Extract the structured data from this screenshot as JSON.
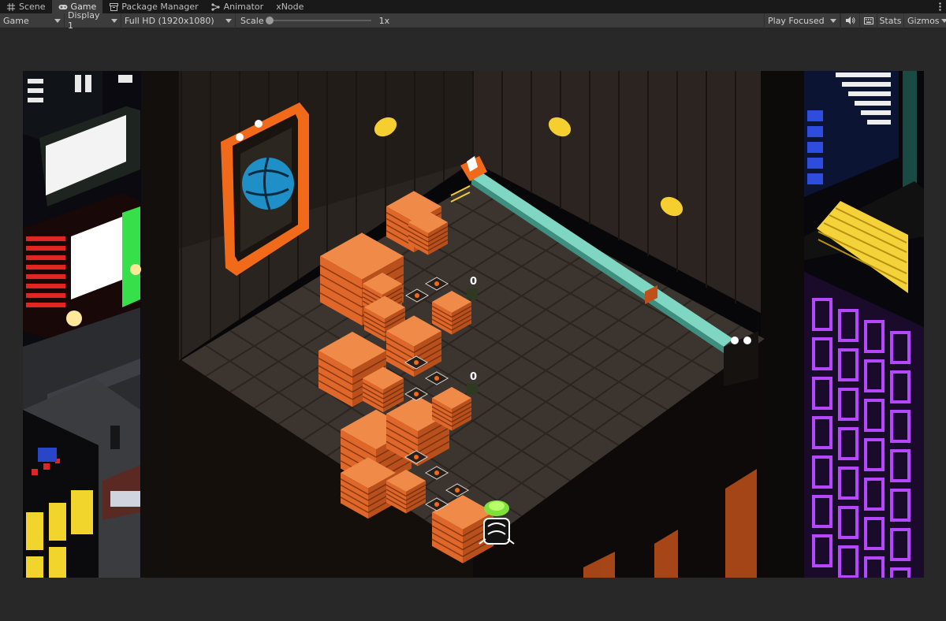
{
  "tabs": [
    {
      "label": "Scene",
      "icon": "grid-icon",
      "active": false
    },
    {
      "label": "Game",
      "icon": "gamepad-icon",
      "active": true
    },
    {
      "label": "Package Manager",
      "icon": "package-icon",
      "active": false
    },
    {
      "label": "Animator",
      "icon": "animator-icon",
      "active": false
    },
    {
      "label": "xNode",
      "icon": "",
      "active": false
    }
  ],
  "toolbar": {
    "view_mode": "Game",
    "display": "Display 1",
    "resolution": "Full HD (1920x1080)",
    "scale_label": "Scale",
    "scale_value": "1x",
    "scale_fraction": 0,
    "play_mode": "Play Focused",
    "stats_label": "Stats",
    "gizmos_label": "Gizmos"
  },
  "game": {
    "counters": [
      "0",
      "0"
    ],
    "palette": {
      "crate": "#e0672a",
      "neon_purple": "#b548ff",
      "neon_yellow": "#f6d63a",
      "conveyor": "#7fd6c3",
      "frame_orange": "#f06a1a"
    }
  }
}
